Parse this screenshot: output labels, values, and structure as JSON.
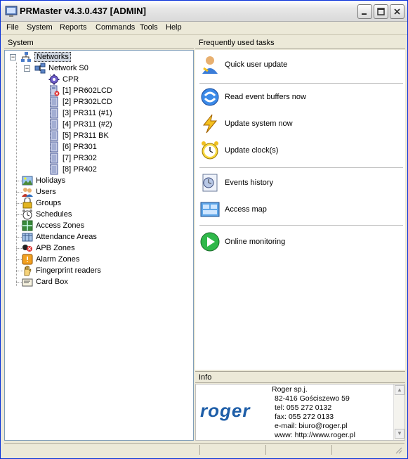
{
  "window": {
    "title": "PRMaster v4.3.0.437 [ADMIN]"
  },
  "menu": [
    "File",
    "System",
    "Reports",
    "Commands",
    "Tools",
    "Help"
  ],
  "left_panel": {
    "header": "System"
  },
  "tree": {
    "networks": "Networks",
    "network_s0": "Network S0",
    "cpr": "CPR",
    "devices": [
      "[1] PR602LCD",
      "[2] PR302LCD",
      "[3] PR311 (#1)",
      "[4] PR311 (#2)",
      "[5] PR311 BK",
      "[6] PR301",
      "[7] PR302",
      "[8] PR402"
    ],
    "items": [
      "Holidays",
      "Users",
      "Groups",
      "Schedules",
      "Access Zones",
      "Attendance Areas",
      "APB Zones",
      "Alarm Zones",
      "Fingerprint readers",
      "Card Box"
    ]
  },
  "tasks_panel": {
    "header": "Frequently used tasks",
    "tasks": [
      "Quick user update",
      "Read event buffers now",
      "Update system now",
      "Update clock(s)",
      "Events history",
      "Access map",
      "Online monitoring"
    ]
  },
  "info_panel": {
    "header": "Info",
    "logo": "roger",
    "company": "Roger sp.j.",
    "address": "82-416 Gościszewo 59",
    "tel": "tel: 055 272 0132",
    "fax": "fax: 055 272 0133",
    "email": "e-mail: biuro@roger.pl",
    "www": "www: http://www.roger.pl"
  },
  "colors": {
    "accent": "#1e5ea8",
    "tree_border": "#7f9db9",
    "face": "#ece9d8"
  }
}
